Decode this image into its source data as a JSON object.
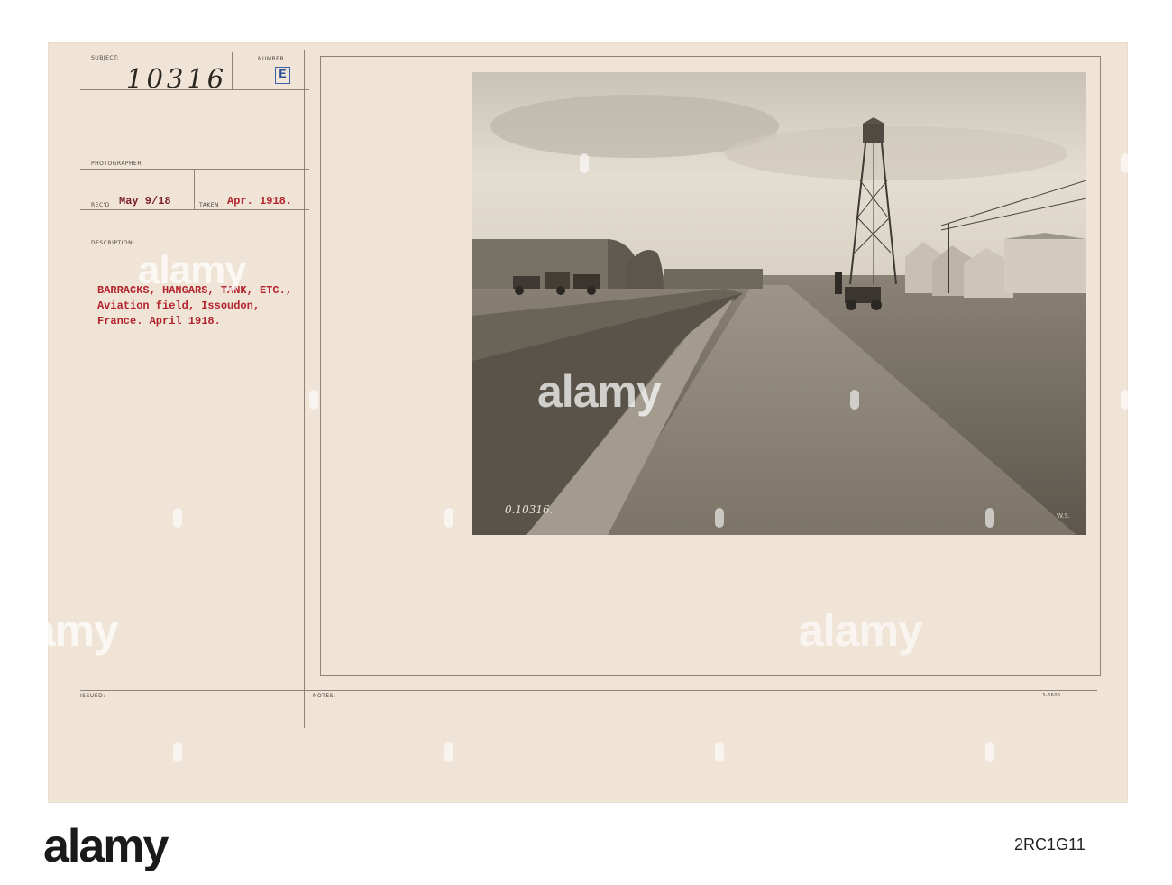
{
  "record": {
    "subject_label": "SUBJECT:",
    "subject_number": "10316",
    "number_label": "NUMBER",
    "number_value": "E",
    "photographer_label": "PHOTOGRAPHER",
    "recd_label": "REC'D",
    "recd_value": "May 9/18",
    "taken_label": "TAKEN",
    "taken_value": "Apr. 1918.",
    "description_label": "DESCRIPTION:",
    "description_lines": [
      "BARRACKS, HANGARS, TANK, ETC.,",
      "Aviation field, Issoudon,",
      "France. April 1918."
    ],
    "issued_label": "ISSUED:",
    "notes_label": "NOTES:",
    "form_code": "3-6605"
  },
  "photo": {
    "negative_number": "0.10316.",
    "corner_mark": "W.S."
  },
  "watermark": {
    "text": "alamy",
    "image_id": "2RC1G11"
  }
}
